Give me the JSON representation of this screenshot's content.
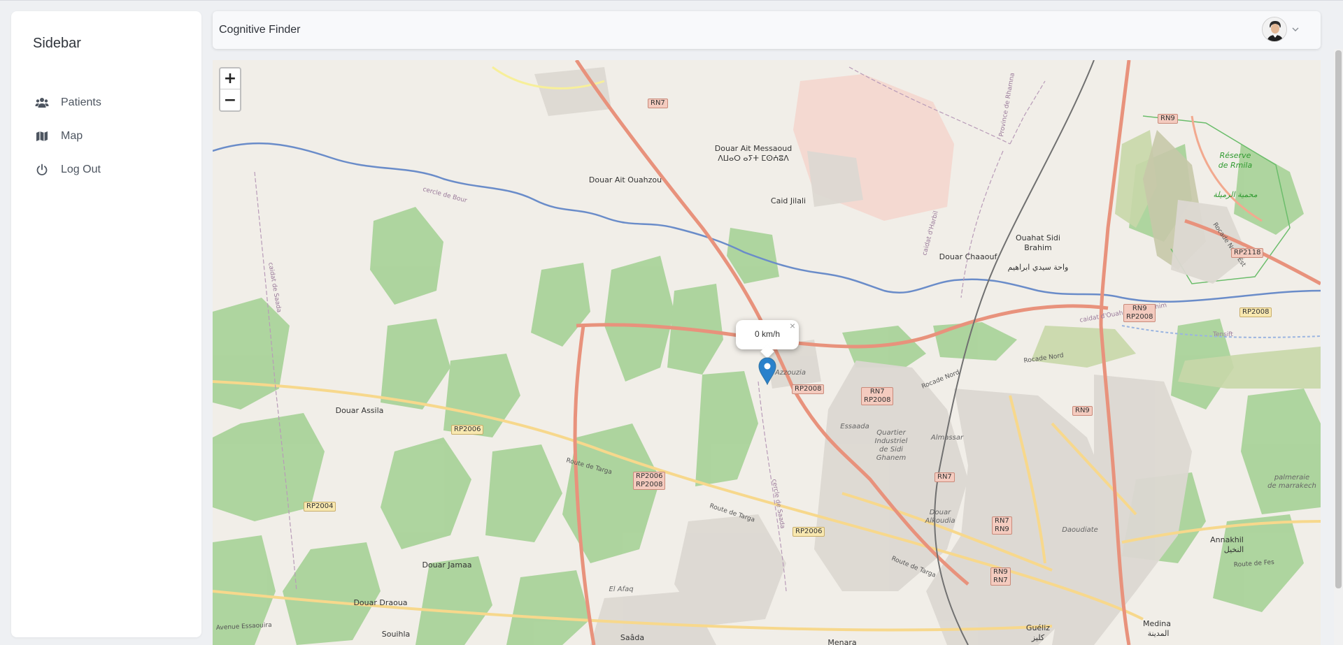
{
  "sidebar": {
    "title": "Sidebar",
    "items": [
      {
        "label": "Patients",
        "icon": "users-icon"
      },
      {
        "label": "Map",
        "icon": "map-icon"
      },
      {
        "label": "Log Out",
        "icon": "power-icon"
      }
    ]
  },
  "header": {
    "title": "Cognitive Finder",
    "user": {
      "avatar": "avatar",
      "menu_icon": "chevron-down-icon"
    }
  },
  "map": {
    "zoom_in": "+",
    "zoom_out": "−",
    "popup": {
      "text": "0 km/h",
      "close": "×"
    },
    "labels": {
      "douar_ait_messaoud": "Douar Ait Messaoud",
      "douar_ait_messaoud_tif": "ⴷⵡⴰⵔ ⴰⵢⵜ ⵎⵙⵄⵓⴷ",
      "douar_ait_ouahzou": "Douar Ait Ouahzou",
      "caid_jilali": "Caid Jilali",
      "douar_chaaouf": "Douar Chaaouf",
      "ouahat_sidi_brahim_1": "Ouahat Sidi",
      "ouahat_sidi_brahim_2": "Brahim",
      "ouahat_ar": "واحة سيدي ابراهيم",
      "reserve_1": "Réserve",
      "reserve_2": "de Rmila",
      "reserve_ar": "محمية الرميلة",
      "douar_assila": "Douar Assila",
      "douar_jamaa": "Douar Jamaa",
      "douar_draoua": "Douar Draoua",
      "souihla": "Souihla",
      "saada": "Saâda",
      "el_afaq": "El Afaq",
      "azzouzia": "Azzouzia",
      "essaada": "Essaada",
      "quartier_1": "Quartier",
      "quartier_2": "Industriel",
      "quartier_3": "de Sidi",
      "quartier_4": "Ghanem",
      "almassar": "Almassar",
      "douar_alkoudia": "Douar",
      "douar_alkoudia_2": "Alkoudia",
      "daoudiate": "Daoudiate",
      "annakhil": "Annakhil",
      "annakhil_ar": "النخيل",
      "palmeraie_1": "palmeraie",
      "palmeraie_2": "de marrakech",
      "medina": "Medina",
      "medina_ar": "المدينة",
      "gueliz": "Guéliz",
      "gueliz_ar": "كليز",
      "menara": "Menara",
      "route_targa_1": "Route de Targa",
      "route_targa_2": "Route de Targa",
      "route_targa_3": "Route de Targa",
      "rocade_nord_1": "Rocade Nord",
      "rocade_nord_2": "Rocade Nord",
      "rocade_nord_est": "Rocade Nord-Est",
      "route_fes": "Route de Fes",
      "avenue_essaouira": "Avenue Essaouira",
      "cercle_bour": "cercle de Bour",
      "caidat_saada": "caidat de Saada",
      "cercle_saada": "cercle de Saada",
      "caidat_harbil": "caidat d'Harbil",
      "province_rhamna": "Province de Rhamna",
      "caidat_ouahat": "caidat d'Ouahat Sidi Brahim",
      "tensift": "Tensift"
    },
    "route_badges": {
      "rn7_top": "RN7",
      "rn9_top": "RN9",
      "rp2118": "RP2118",
      "rn9_rp2008_a": "RN9",
      "rn9_rp2008_b": "RP2008",
      "rp2008_right": "RP2008",
      "rp2008_mid": "RP2008",
      "rn7_rp2008_a": "RN7",
      "rn7_rp2008_b": "RP2008",
      "rn9_mid": "RN9",
      "rp2006_left": "RP2006",
      "rp2006_rp2008_a": "RP2006",
      "rp2006_rp2008_b": "RP2008",
      "rn7_mid": "RN7",
      "rp2004": "RP2004",
      "rp2006_low": "RP2006",
      "rn7_rn9_a": "RN7",
      "rn7_rn9_b": "RN9",
      "rn9_rn7_a": "RN9",
      "rn9_rn7_b": "RN7"
    }
  },
  "colors": {
    "accent_marker": "#2a81cb",
    "primary_road": "#e8927c",
    "secondary_road": "#f7d88c",
    "river": "#6a8cc9",
    "park": "#aad39b"
  }
}
